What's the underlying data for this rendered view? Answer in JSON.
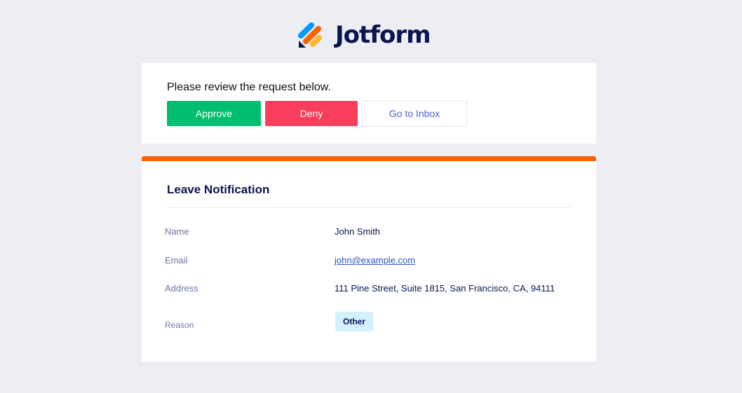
{
  "brand": {
    "name": "Jotform",
    "logo_icon": "jotform-logo-icon"
  },
  "review": {
    "prompt": "Please review the request below.",
    "approve_label": "Approve",
    "deny_label": "Deny",
    "inbox_label": "Go to Inbox"
  },
  "form": {
    "title": "Leave Notification",
    "fields": [
      {
        "label": "Name",
        "value": "John Smith"
      },
      {
        "label": "Email",
        "value": "john@example.com"
      },
      {
        "label": "Address",
        "value": "111 Pine Street, Suite 1815, San Francisco, CA, 94111"
      },
      {
        "label": "Reason",
        "value": "Other"
      }
    ]
  },
  "colors": {
    "background": "#eceef3",
    "approve": "#01bd6f",
    "deny": "#f93d5c",
    "accent_bar": "#ff6100",
    "navy": "#0a1551",
    "link": "#2c53c6",
    "tag_bg": "#d5f0ff"
  }
}
